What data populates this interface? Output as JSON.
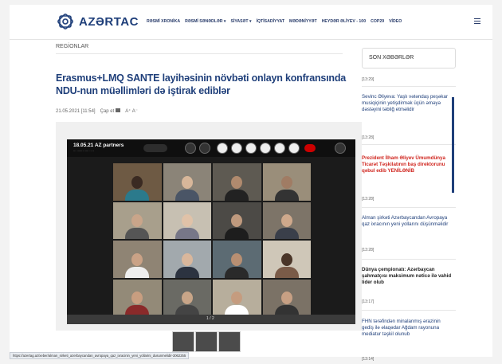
{
  "header": {
    "logo_text": "AZƏRTAC",
    "nav": [
      "RƏSMİ XRONİKA",
      "RƏSMİ SƏNƏDLƏR ▾",
      "SİYASƏT ▾",
      "İQTİSADİYYAT",
      "MƏDƏNİYYƏT",
      "HEYDƏR ƏLİYEV - 100",
      "COP29",
      "VİDEO"
    ]
  },
  "article": {
    "section": "REGİONLAR",
    "title": "Erasmus+LMQ SANTE layihəsinin növbəti onlayn konfransında NDU-nun müəllimləri də iştirak ediblər",
    "datetime": "21.05.2021 [11:54]",
    "print_label": "Çap et",
    "font_controls": "A⁺ A⁻"
  },
  "video": {
    "title": "18.05.21 AZ partners",
    "subtitle": "··· ········ ···· ·· ··",
    "pager": "1 / 2"
  },
  "sidebar": {
    "heading": "SON XƏBƏRLƏR",
    "items": [
      {
        "time": "[13:29]",
        "text": ""
      },
      {
        "text": "Sevinc Əliyeva: Yaşlı vətəndaş peşəkar musiqiçinin yetişdirmək üçün əməyə dəstəyini təbliğ etməlidir",
        "time": "[13:28]"
      },
      {
        "text": "Prezident İlham Əliyev Ümumdünya Ticarət Təşkilatının baş direktorunu qəbul edib YENİLƏNİB",
        "time": "[13:28]"
      },
      {
        "text": "Alman şirkəti Azərbaycandan Avropaya qaz ixracının yeni yollarını düşünməlidir",
        "time": "[13:28]"
      },
      {
        "text": "Dünya çempionatı: Azərbaycan şahmatçısı maksimum nəticə ilə vahid lider olub",
        "time": "[13:17]"
      },
      {
        "text": "FHN tərəfindən minalanmış ərazinin gediş ilə əlaqədar Ağdam rayonuna mediatur təşkil olunub",
        "time": "[13:14]"
      }
    ]
  },
  "statusbar": {
    "url": "https://azertag.az/xeber/alman_sirketi_azerbaycandan_avropaya_qaz_ixracinin_yeni_yollarini_dusunmelidir-3062255"
  },
  "colors": {
    "brand": "#1f3f7a",
    "accent_red": "#d0261f"
  }
}
